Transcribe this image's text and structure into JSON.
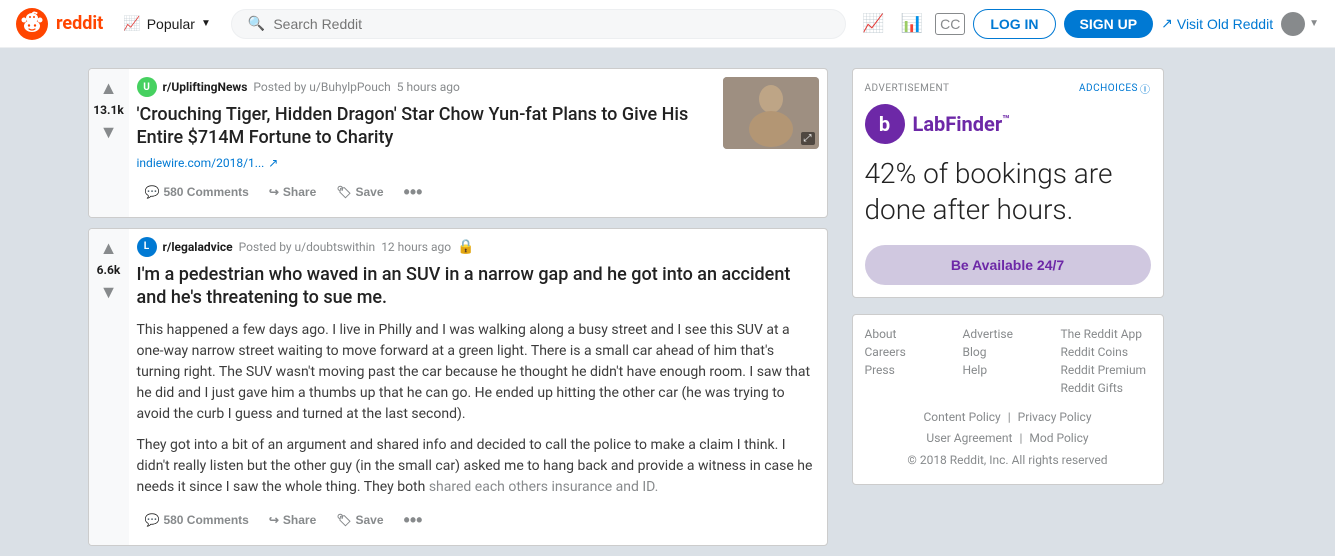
{
  "header": {
    "logo_text": "reddit",
    "popular_label": "Popular",
    "search_placeholder": "Search Reddit",
    "login_label": "LOG IN",
    "signup_label": "SIGN UP",
    "visit_old_label": "Visit Old Reddit"
  },
  "posts": [
    {
      "id": "post-1",
      "vote_count": "13.1k",
      "subreddit": "r/UpliftingNews",
      "subreddit_color": "green",
      "posted_by": "Posted by u/BuhylpPouch",
      "time_ago": "5 hours ago",
      "title": "'Crouching Tiger, Hidden Dragon' Star Chow Yun-fat Plans to Give His Entire $714M Fortune to Charity",
      "link_text": "indiewire.com/2018/1...",
      "comments_count": "580 Comments",
      "share_label": "Share",
      "save_label": "Save",
      "has_thumbnail": true,
      "thumbnail_bg": "linear-gradient(135deg, #888 0%, #bbb 100%)",
      "has_lock": false
    },
    {
      "id": "post-2",
      "vote_count": "6.6k",
      "subreddit": "r/legaladvice",
      "subreddit_color": "blue",
      "posted_by": "Posted by u/doubtswithin",
      "time_ago": "12 hours ago",
      "title": "I'm a pedestrian who waved in an SUV in a narrow gap and he got into an accident and he's threatening to sue me.",
      "body_text_1": "This happened a few days ago. I live in Philly and I was walking along a busy street and I see this SUV at a one-way narrow street waiting to move forward at a green light. There is a small car ahead of him that's turning right. The SUV wasn't moving past the car because he thought he didn't have enough room. I saw that he did and I just gave him a thumbs up that he can go. He ended up hitting the other car (he was trying to avoid the curb I guess and turned at the last second).",
      "body_text_2": "They got into a bit of an argument and shared info and decided to call the police to make a claim I think. I didn't really listen but the other guy (in the small car) asked me to hang back and provide a witness in case he needs it since I saw the whole thing. They both shared each others insurance and ID.",
      "comments_count": "580 Comments",
      "share_label": "Share",
      "save_label": "Save",
      "has_thumbnail": false,
      "has_lock": true
    }
  ],
  "ad": {
    "label": "ADVERTISEMENT",
    "adchoices_label": "AdChoices",
    "logo_letter": "b",
    "brand_name_part1": "Lab",
    "brand_name_part2": "Finder",
    "trademark": "™",
    "headline": "42% of bookings are done after hours.",
    "cta_label": "Be Available 24/7"
  },
  "footer": {
    "links": [
      {
        "label": "About"
      },
      {
        "label": "Advertise"
      },
      {
        "label": "The Reddit App"
      },
      {
        "label": "Careers"
      },
      {
        "label": "Blog"
      },
      {
        "label": "Reddit Coins"
      },
      {
        "label": "Press"
      },
      {
        "label": "Help"
      },
      {
        "label": "Reddit Premium"
      },
      {
        "label": ""
      },
      {
        "label": ""
      },
      {
        "label": "Reddit Gifts"
      }
    ],
    "policy_line1_part1": "Content Policy",
    "policy_line1_sep": "|",
    "policy_line1_part2": "Privacy Policy",
    "policy_line2_part1": "User Agreement",
    "policy_line2_sep": "|",
    "policy_line2_part2": "Mod Policy",
    "copyright": "© 2018 Reddit, Inc. All rights reserved"
  }
}
